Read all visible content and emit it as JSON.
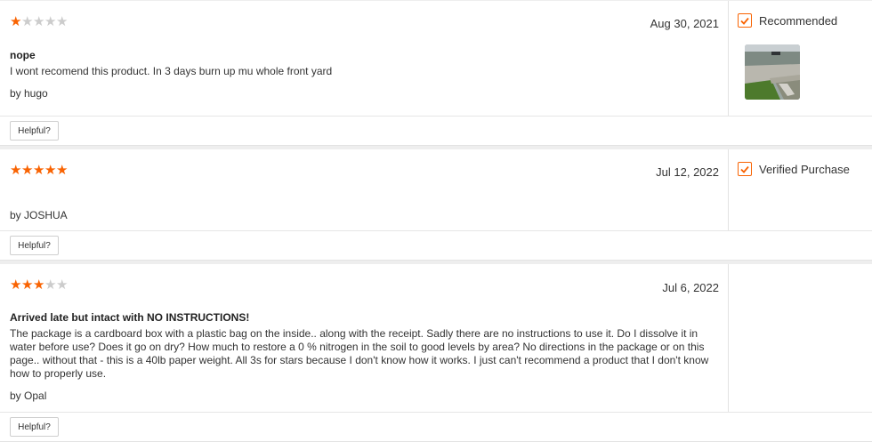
{
  "colors": {
    "accent": "#f96302",
    "star_off": "#cccccc"
  },
  "reviews": [
    {
      "rating": 1,
      "date": "Aug 30, 2021",
      "title": "nope",
      "body": "I wont recomend this product. In 3 days burn up mu whole front yard",
      "author": "by hugo",
      "badge": "Recommended",
      "helpful": "Helpful?"
    },
    {
      "rating": 5,
      "date": "Jul 12, 2022",
      "title": "",
      "body": "",
      "author": "by JOSHUA",
      "badge": "Verified Purchase",
      "helpful": "Helpful?"
    },
    {
      "rating": 3,
      "date": "Jul 6, 2022",
      "title": "Arrived late but intact with NO INSTRUCTIONS!",
      "body": "The package is a cardboard box with a plastic bag on the inside.. along with the receipt. Sadly there are no instructions to use it.  Do I dissolve it in water before use?  Does it go on dry?  How much to restore a 0 % nitrogen in the soil to good levels by area?   No directions in the package or on this page.. without that - this is a 40lb paper weight.  All 3s for stars because I don't know how it works.  I just can't recommend a product that I don't know how to properly use.",
      "author": "by Opal",
      "badge": "",
      "helpful": "Helpful?"
    }
  ]
}
